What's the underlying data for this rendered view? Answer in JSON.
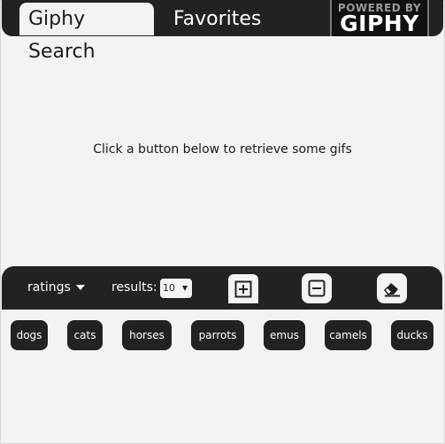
{
  "header": {
    "tabs": [
      {
        "label": "Giphy Search",
        "active": true
      },
      {
        "label": "Favorites",
        "active": false
      }
    ],
    "logo": {
      "top_text": "POWERED BY",
      "brand_text": "GIPHY"
    }
  },
  "main": {
    "message": "Click a button below to retrieve some gifs"
  },
  "controls": {
    "ratings_label": "ratings",
    "results_label": "results:",
    "results_value": "10",
    "buttons": [
      {
        "icon": "plus-square-icon"
      },
      {
        "icon": "minus-square-icon"
      },
      {
        "icon": "eraser-icon"
      }
    ]
  },
  "animals": [
    "dogs",
    "cats",
    "horses",
    "parrots",
    "emus",
    "camels",
    "ducks"
  ],
  "colors": {
    "dark": "#222222",
    "background": "#f3f3f3",
    "text_light": "#ffffff"
  }
}
